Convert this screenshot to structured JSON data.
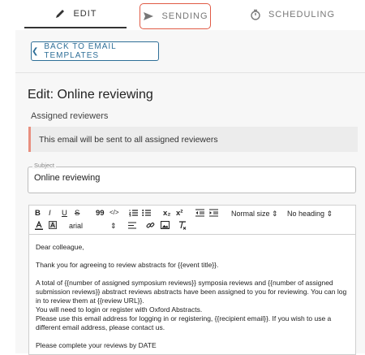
{
  "tabs": {
    "edit": "EDIT",
    "sending": "SENDING",
    "scheduling": "SCHEDULING"
  },
  "back_button": "BACK TO EMAIL TEMPLATES",
  "page_title": "Edit: Online reviewing",
  "section_label": "Assigned reviewers",
  "alert_text": "This email will be sent to all assigned reviewers",
  "subject": {
    "label": "Subject",
    "value": "Online reviewing"
  },
  "toolbar": {
    "bold": "B",
    "italic": "I",
    "underline": "U",
    "strike": "S",
    "quote": "99",
    "code": "</>",
    "subscript": "x₂",
    "superscript": "x²",
    "font_size": "Normal size",
    "heading": "No heading",
    "font_family": "arial"
  },
  "body_lines": [
    "Dear colleague,",
    "",
    "Thank you for agreeing to review abstracts for {{event title}}.",
    "",
    "A total of {{number of assigned symposium reviews}} symposia reviews and {{number of assigned submission reviews}} abstract reviews abstracts have been assigned to you for reviewing. You can log in to review them at {{review URL}}.",
    "You will need to login or register with Oxford Abstracts.",
    "Please use this email address for logging in or registering, {{recipient email}}. If you wish to use a different email address, please contact us.",
    "",
    "Please complete your reviews by DATE"
  ],
  "colors": {
    "accent": "#2f6f98",
    "highlight": "#e05a45",
    "alert_border": "#e88f7f"
  }
}
